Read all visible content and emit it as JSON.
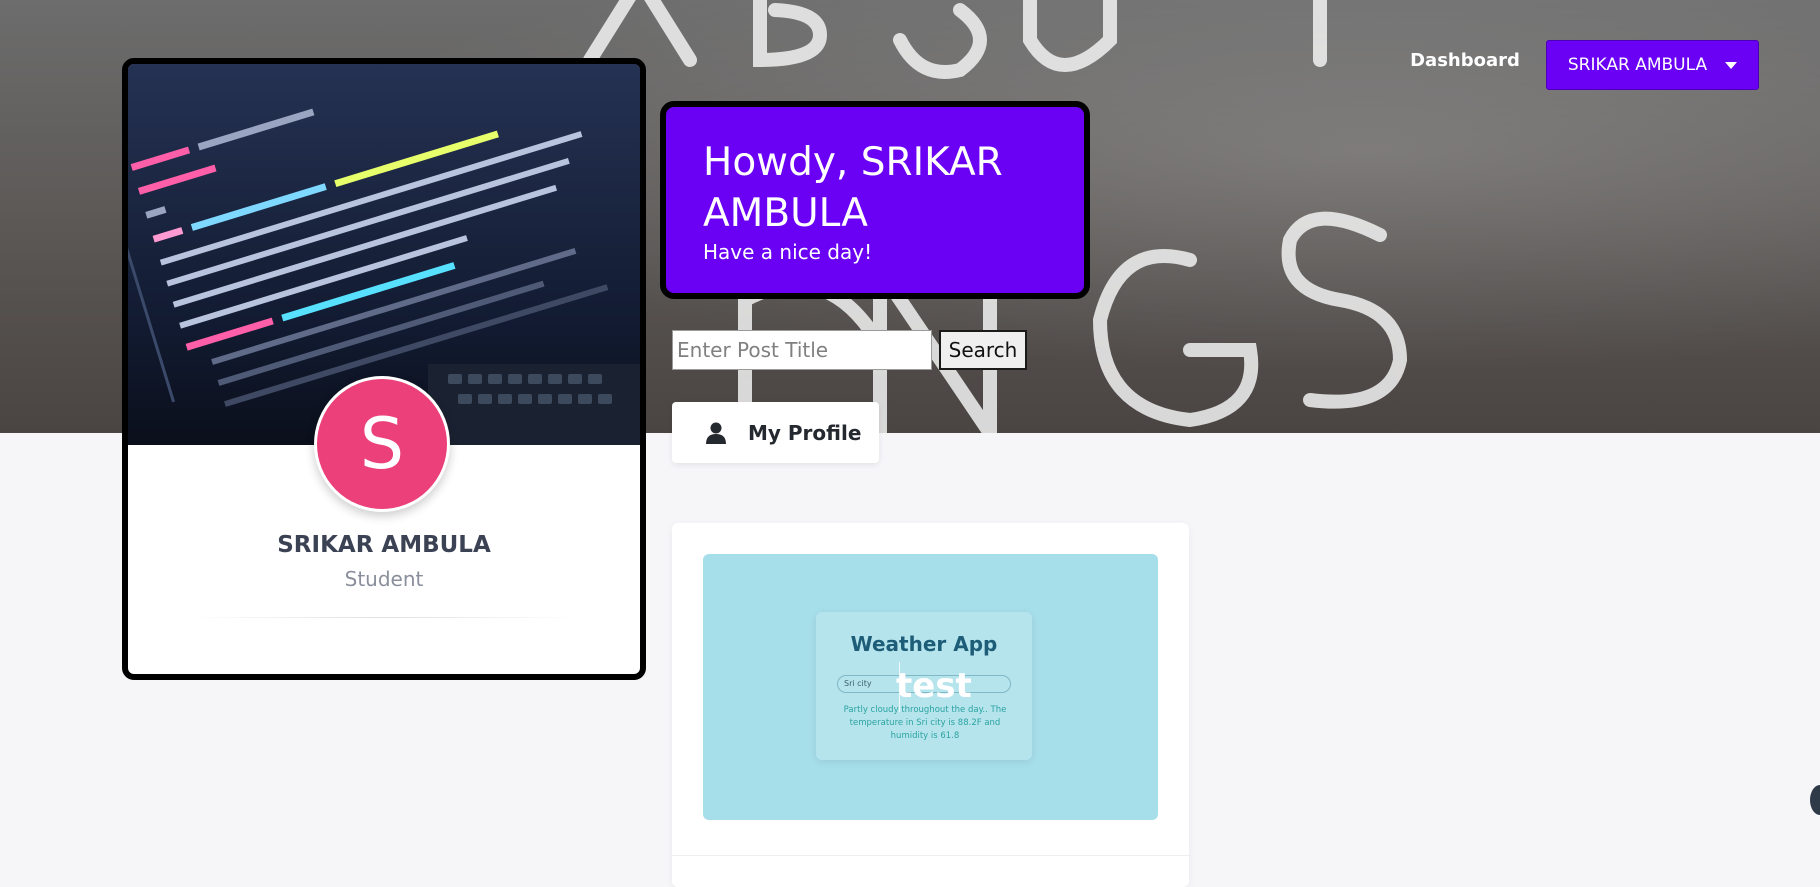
{
  "nav": {
    "dashboard": "Dashboard",
    "user_menu": "SRIKAR AMBULA"
  },
  "hero": {
    "background_icon": "neon-sign-background"
  },
  "profile": {
    "avatar_initial": "S",
    "name": "SRIKAR AMBULA",
    "role": "Student",
    "avatar_color": "#ec407a"
  },
  "greeting": {
    "title": "Howdy, SRIKAR AMBULA",
    "subtitle": "Have a nice day!"
  },
  "search": {
    "placeholder": "Enter Post Title",
    "button": "Search"
  },
  "my_profile": {
    "label": "My Profile",
    "icon": "user-icon"
  },
  "post": {
    "thumb_title": "Weather App",
    "thumb_input": "Sri city",
    "thumb_text": "Partly cloudy throughout the day.. The temperature in Sri city is 88.2F and humidity is 61.8",
    "title": "test"
  },
  "colors": {
    "accent": "#6a00f4",
    "background": "#f6f6f9",
    "thumb_bg": "#a6deea"
  }
}
